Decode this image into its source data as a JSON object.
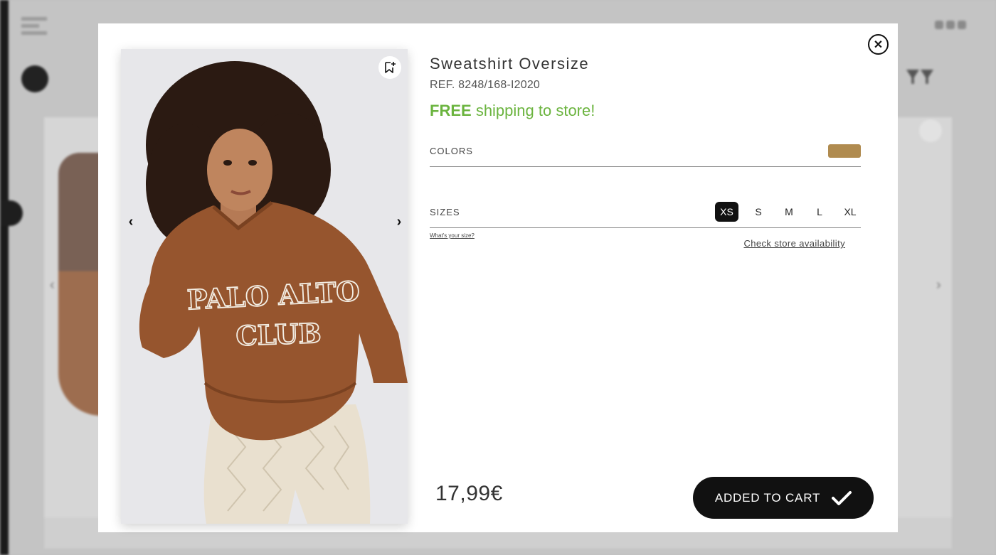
{
  "product": {
    "title": "Sweatshirt Oversize",
    "reference": "REF. 8248/168-I2020",
    "shipping_highlight": "FREE",
    "shipping_text": "shipping to store!",
    "price": "17,99€"
  },
  "image": {
    "print_line1": "PALO ALTO",
    "print_line2": "CLUB"
  },
  "colors": {
    "label": "COLORS",
    "swatches": [
      "#b08b4f"
    ]
  },
  "sizes": {
    "label": "SIZES",
    "options": [
      "XS",
      "S",
      "M",
      "L",
      "XL"
    ],
    "selected": "XS",
    "guide_link": "What's your size?",
    "store_link": "Check store availability"
  },
  "actions": {
    "cart_label": "ADDED TO CART"
  },
  "icons": {
    "close": "close-icon",
    "wishlist": "bookmark-add-icon",
    "prev": "chevron-left-icon",
    "next": "chevron-right-icon",
    "check": "checkmark-icon"
  },
  "theme": {
    "accent_green": "#6bb43f",
    "button_black": "#111111"
  }
}
